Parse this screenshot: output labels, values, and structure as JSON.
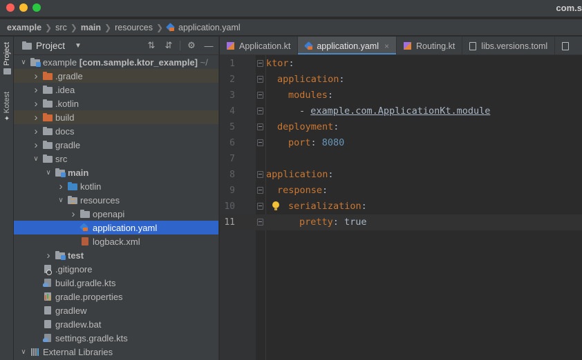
{
  "window": {
    "title_partial": "com.s"
  },
  "breadcrumb": [
    {
      "label": "example",
      "bold": true
    },
    {
      "label": "src",
      "bold": false
    },
    {
      "label": "main",
      "bold": true
    },
    {
      "label": "resources",
      "bold": false
    },
    {
      "label": "application.yaml",
      "bold": false,
      "icon": "yaml-file-icon"
    }
  ],
  "toolstrip": {
    "project_label": "Project",
    "kotest_label": "Kotest"
  },
  "project_panel": {
    "title": "Project",
    "tree": [
      {
        "depth": 0,
        "arrow": "down",
        "icon": "module-folder",
        "label": "example",
        "suffix": "[com.sample.ktor_example]",
        "trail": " ~/",
        "bold": false
      },
      {
        "depth": 1,
        "arrow": "right",
        "icon": "folder-orange",
        "label": ".gradle",
        "excluded": true
      },
      {
        "depth": 1,
        "arrow": "right",
        "icon": "folder",
        "label": ".idea"
      },
      {
        "depth": 1,
        "arrow": "right",
        "icon": "folder",
        "label": ".kotlin"
      },
      {
        "depth": 1,
        "arrow": "right",
        "icon": "folder-orange",
        "label": "build",
        "excluded": true
      },
      {
        "depth": 1,
        "arrow": "right",
        "icon": "folder",
        "label": "docs"
      },
      {
        "depth": 1,
        "arrow": "right",
        "icon": "folder",
        "label": "gradle"
      },
      {
        "depth": 1,
        "arrow": "down",
        "icon": "folder",
        "label": "src"
      },
      {
        "depth": 2,
        "arrow": "down",
        "icon": "module-folder",
        "label": "main",
        "bold": true
      },
      {
        "depth": 3,
        "arrow": "right",
        "icon": "folder-blue",
        "label": "kotlin"
      },
      {
        "depth": 3,
        "arrow": "down",
        "icon": "resources-folder",
        "label": "resources"
      },
      {
        "depth": 4,
        "arrow": "right",
        "icon": "folder",
        "label": "openapi"
      },
      {
        "depth": 4,
        "arrow": "",
        "icon": "yaml-file",
        "label": "application.yaml",
        "selected": true
      },
      {
        "depth": 4,
        "arrow": "",
        "icon": "xml-file",
        "label": "logback.xml"
      },
      {
        "depth": 2,
        "arrow": "right",
        "icon": "module-folder",
        "label": "test",
        "bold": true
      },
      {
        "depth": 1,
        "arrow": "",
        "icon": "gitignore-file",
        "label": ".gitignore"
      },
      {
        "depth": 1,
        "arrow": "",
        "icon": "gradle-file",
        "label": "build.gradle.kts"
      },
      {
        "depth": 1,
        "arrow": "",
        "icon": "properties-file",
        "label": "gradle.properties"
      },
      {
        "depth": 1,
        "arrow": "",
        "icon": "file",
        "label": "gradlew"
      },
      {
        "depth": 1,
        "arrow": "",
        "icon": "file",
        "label": "gradlew.bat"
      },
      {
        "depth": 1,
        "arrow": "",
        "icon": "gradle-file",
        "label": "settings.gradle.kts"
      },
      {
        "depth": 0,
        "arrow": "down",
        "icon": "libraries",
        "label": "External Libraries"
      }
    ]
  },
  "editor": {
    "tabs": [
      {
        "label": "Application.kt",
        "icon": "kotlin-file-icon",
        "active": false,
        "close": ""
      },
      {
        "label": "application.yaml",
        "icon": "yaml-file-icon",
        "active": true,
        "close": "×"
      },
      {
        "label": "Routing.kt",
        "icon": "kotlin-file-icon",
        "active": false,
        "close": ""
      },
      {
        "label": "libs.versions.toml",
        "icon": "toml-file-icon",
        "active": false,
        "close": ""
      }
    ],
    "current_line": 11,
    "lines": [
      {
        "n": "1",
        "indent": 0,
        "key": "ktor",
        "sep": ":",
        "value": "",
        "value_type": "",
        "fold": true
      },
      {
        "n": "2",
        "indent": 1,
        "key": "application",
        "sep": ":",
        "value": "",
        "value_type": "",
        "fold": true
      },
      {
        "n": "3",
        "indent": 2,
        "key": "modules",
        "sep": ":",
        "value": "",
        "value_type": "",
        "fold": true
      },
      {
        "n": "4",
        "indent": 3,
        "key": "",
        "sep": "- ",
        "value": "example.com.ApplicationKt.module",
        "value_type": "link",
        "fold": true
      },
      {
        "n": "5",
        "indent": 1,
        "key": "deployment",
        "sep": ":",
        "value": "",
        "value_type": "",
        "fold": true
      },
      {
        "n": "6",
        "indent": 2,
        "key": "port",
        "sep": ": ",
        "value": "8080",
        "value_type": "number",
        "fold": true
      },
      {
        "n": "7",
        "indent": 0,
        "key": "",
        "sep": "",
        "value": "",
        "value_type": "",
        "fold": false
      },
      {
        "n": "8",
        "indent": 0,
        "key": "application",
        "sep": ":",
        "value": "",
        "value_type": "",
        "fold": true
      },
      {
        "n": "9",
        "indent": 1,
        "key": "response",
        "sep": ":",
        "value": "",
        "value_type": "",
        "fold": true
      },
      {
        "n": "10",
        "indent": 2,
        "key": "serialization",
        "sep": ":",
        "value": "",
        "value_type": "",
        "fold": true,
        "bulb": true
      },
      {
        "n": "11",
        "indent": 3,
        "key": "pretty",
        "sep": ": ",
        "value": "true",
        "value_type": "plain",
        "fold": true
      }
    ]
  },
  "colors": {
    "yaml_key": "#cc7832",
    "yaml_number": "#6897bb",
    "selection": "#2f65ca",
    "excluded_row": "#45433a"
  }
}
